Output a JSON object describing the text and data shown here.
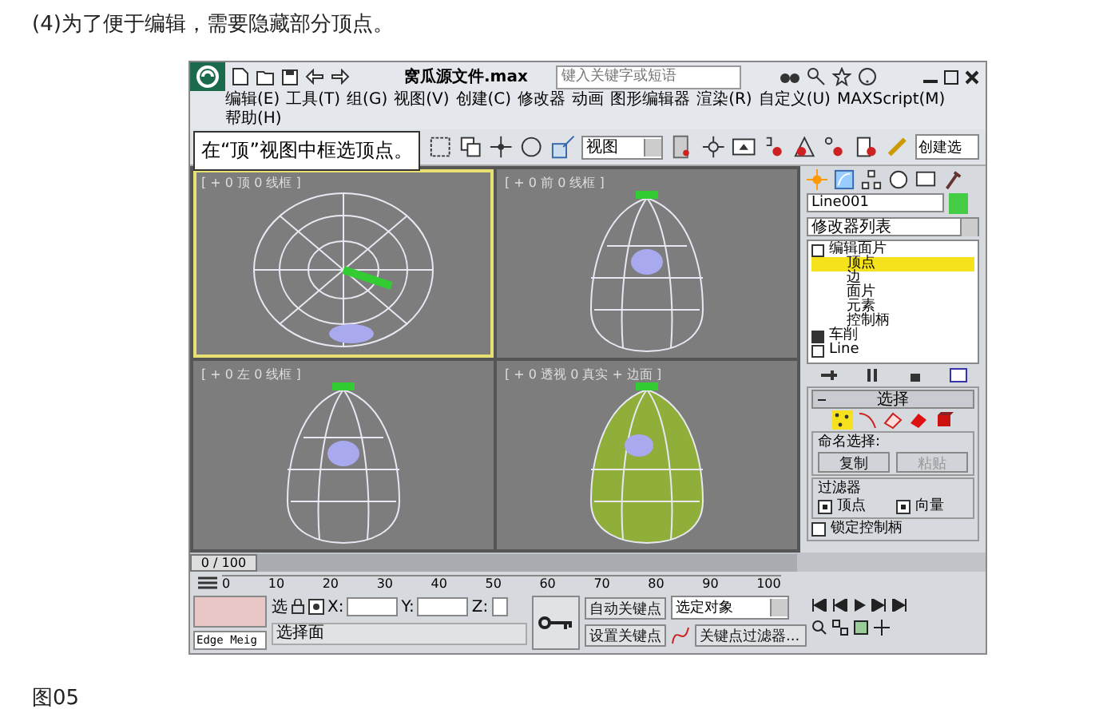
{
  "intro": "(4)为了便于编辑，需要隐藏部分顶点。",
  "window": {
    "title": "窝瓜源文件.max",
    "search": {
      "placeholder": "键入关键字或短语"
    }
  },
  "menu": [
    "编辑(E)",
    "工具(T)",
    "组(G)",
    "视图(V)",
    "创建(C)",
    "修改器",
    "动画",
    "图形编辑器",
    "渲染(R)",
    "自定义(U)",
    "MAXScript(M)",
    "帮助(H)"
  ],
  "callout": "在“顶”视图中框选顶点。",
  "toolbar": {
    "coord_dropdown": "视图",
    "selection_set_field": "创建选"
  },
  "viewports": [
    {
      "label": "[ + 0 顶 0 线框 ]",
      "selected": true,
      "kind": "top"
    },
    {
      "label": "[ + 0 前 0 线框 ]",
      "selected": false,
      "kind": "front"
    },
    {
      "label": "[ + 0 左 0 线框 ]",
      "selected": false,
      "kind": "left"
    },
    {
      "label": "[ + 0 透视 0 真实 + 边面 ]",
      "selected": false,
      "kind": "perspective"
    }
  ],
  "command_panel": {
    "object_name": "Line001",
    "modifier_list": "修改器列表",
    "stack": [
      {
        "label": "编辑面片",
        "expanded": true,
        "children": [
          {
            "label": "顶点",
            "selected": true
          },
          {
            "label": "边",
            "selected": false
          },
          {
            "label": "面片",
            "selected": false
          },
          {
            "label": "元素",
            "selected": false
          },
          {
            "label": "控制柄",
            "selected": false
          }
        ]
      },
      {
        "label": "车削",
        "expanded": false
      },
      {
        "label": "Line",
        "expanded": true
      }
    ],
    "selection_rollout": {
      "title": "选择",
      "levels": [
        {
          "kind": "vertex",
          "selected": true
        },
        {
          "kind": "handle",
          "selected": false
        },
        {
          "kind": "patch",
          "selected": false
        },
        {
          "kind": "element",
          "selected": false
        },
        {
          "kind": "box",
          "selected": false
        }
      ],
      "named_label": "命名选择:",
      "buttons": [
        {
          "label": "复制",
          "disabled": false
        },
        {
          "label": "粘贴",
          "disabled": true
        }
      ],
      "filter_label": "过滤器",
      "filters": [
        {
          "label": "顶点",
          "checked": true
        },
        {
          "label": "向量",
          "checked": true
        }
      ],
      "lock": {
        "label": "锁定控制柄",
        "checked": false
      }
    }
  },
  "timeline": {
    "position": "0 / 100",
    "level": 0,
    "ruler": [
      "0",
      "10",
      "20",
      "30",
      "40",
      "50",
      "60",
      "70",
      "80",
      "90",
      "100"
    ]
  },
  "status": {
    "object_field": "Edge Meig",
    "lock_label": "选",
    "x_label": "X:",
    "y_label": "Y:",
    "z_label": "Z:",
    "auto_key": "自动关键点",
    "set_key": "设置关键点",
    "key_mode": "选定对象",
    "key_filters": "关键点过滤器...",
    "prompt": "选择面"
  },
  "caption": "图05"
}
